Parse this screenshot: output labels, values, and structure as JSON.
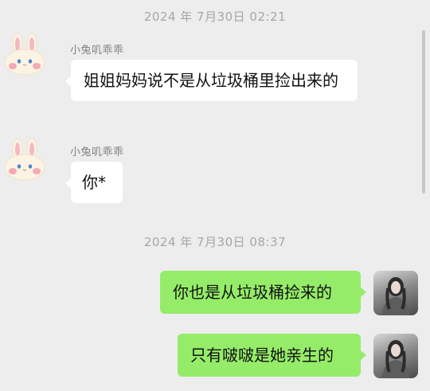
{
  "chat": {
    "timestamps": [
      "2024 年 7月30日 02:21",
      "2024 年 7月30日 08:37"
    ],
    "messages": [
      {
        "sender": "小兔叽乖乖",
        "direction": "incoming",
        "text": "姐姐妈妈说不是从垃圾桶里捡出来的"
      },
      {
        "sender": "小兔叽乖乖",
        "direction": "incoming",
        "text": "你*"
      },
      {
        "direction": "outgoing",
        "text": "你也是从垃圾桶捡来的"
      },
      {
        "direction": "outgoing",
        "text": "只有啵啵是她亲生的"
      }
    ],
    "avatars": {
      "contact": "bunny-avatar-icon",
      "self": "user-photo-avatar"
    },
    "colors": {
      "background": "#ededed",
      "incoming_bubble": "#ffffff",
      "outgoing_bubble": "#95ec69",
      "timestamp": "#a6a6a6",
      "sender_name": "#7f7f7f"
    }
  }
}
